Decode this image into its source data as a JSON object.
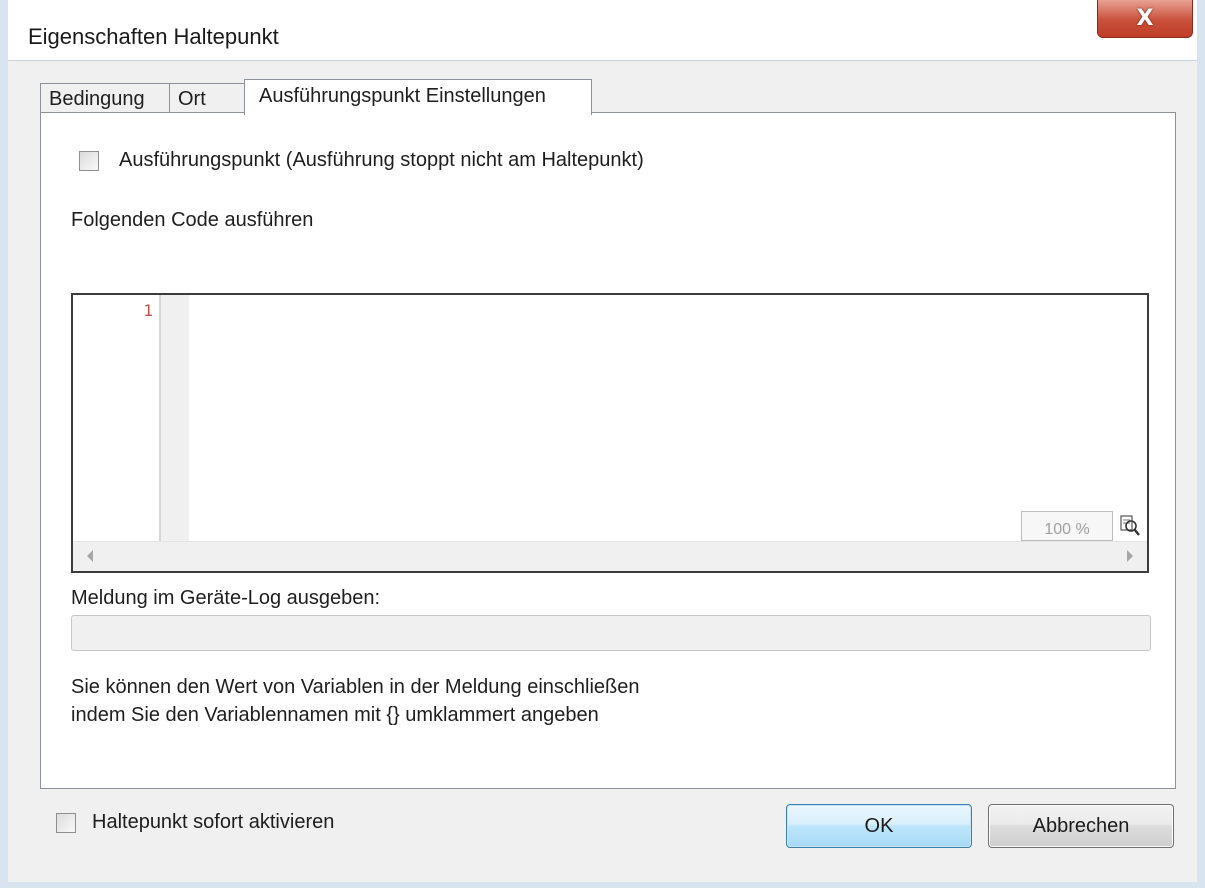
{
  "window": {
    "title": "Eigenschaften Haltepunkt",
    "close_label": "X"
  },
  "tabs": [
    {
      "label": "Bedingung",
      "active": false
    },
    {
      "label": "Ort",
      "active": false
    },
    {
      "label": "Ausführungspunkt Einstellungen",
      "active": true
    }
  ],
  "panel": {
    "tracepoint_checkbox": {
      "label": "Ausführungspunkt (Ausführung stoppt nicht am Haltepunkt)",
      "checked": false
    },
    "code_label": "Folgenden Code ausführen",
    "editor": {
      "line_number": "1",
      "zoom": "100 %",
      "zoom_icon": "magnifier-icon"
    },
    "log_label": "Meldung im Geräte-Log ausgeben:",
    "log_value": "",
    "hint_line1": "Sie können den Wert von Variablen in der Meldung einschließen",
    "hint_line2": "indem Sie den Variablennamen mit {} umklammert angeben"
  },
  "footer": {
    "activate_checkbox": {
      "label": "Haltepunkt sofort aktivieren",
      "checked": false
    },
    "ok_label": "OK",
    "cancel_label": "Abbrechen"
  },
  "colors": {
    "close_button": "#c9503b",
    "line_number": "#c0504d",
    "ok_button_border": "#3c7fb1"
  }
}
